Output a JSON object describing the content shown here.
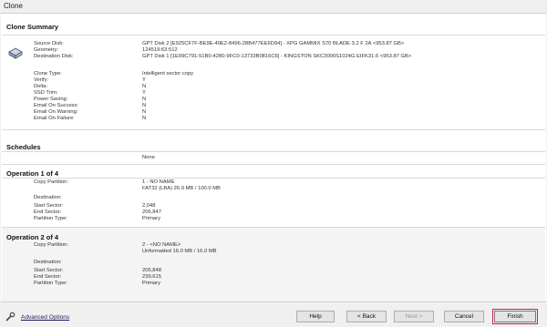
{
  "window": {
    "title": "Clone"
  },
  "clone_summary": {
    "header": "Clone Summary",
    "rows": [
      {
        "label": "Source Disk:",
        "value": "GPT Disk 2 [E925CF7F-BE9E-40E2-8496-28B477EE6D94] - XPG GAMMIX S70 BLADE 3.2 F 2A  <953.87 GB>"
      },
      {
        "label": "Geometry:",
        "value": "124519:63:512"
      },
      {
        "label": "Destination Disk:",
        "value": "GPT Disk 1 [1E09C791-51B0-4280-9FC0-13733B0816C6] - KINGSTON SKC3000S1024G EIFK31.6  <953.87 GB>"
      },
      {
        "label": "Clone Type:",
        "value": "Intelligent sector copy"
      },
      {
        "label": "Verify:",
        "value": "Y"
      },
      {
        "label": "Delta:",
        "value": "N"
      },
      {
        "label": "SSD Trim:",
        "value": "Y"
      },
      {
        "label": "Power Saving:",
        "value": "N"
      },
      {
        "label": "Email On Success:",
        "value": "N"
      },
      {
        "label": "Email On Warning:",
        "value": "N"
      },
      {
        "label": "Email On Failure:",
        "value": "N"
      }
    ]
  },
  "schedules": {
    "header": "Schedules",
    "value": "None"
  },
  "operation1": {
    "header": "Operation 1 of 4",
    "rows": [
      {
        "label": "Copy Partition:",
        "value": "1 - NO NAME"
      },
      {
        "label": "",
        "value": "FAT32 (LBA) 26.9 MB / 100.0 MB"
      },
      {
        "label": "Destination:",
        "value": ""
      },
      {
        "label": "Start Sector:",
        "value": "2,048"
      },
      {
        "label": "End Sector:",
        "value": "206,847"
      },
      {
        "label": "Partition Type:",
        "value": "Primary"
      }
    ]
  },
  "operation2": {
    "header": "Operation 2 of 4",
    "rows": [
      {
        "label": "Copy Partition:",
        "value": "2 - <NO NAME>"
      },
      {
        "label": "",
        "value": "Unformatted 16.0 MB / 16.0 MB"
      },
      {
        "label": "Destination:",
        "value": ""
      },
      {
        "label": "Start Sector:",
        "value": "206,848"
      },
      {
        "label": "End Sector:",
        "value": "239,615"
      },
      {
        "label": "Partition Type:",
        "value": "Primary"
      }
    ]
  },
  "footer": {
    "advanced_options": "Advanced Options",
    "help": "Help",
    "back": "< Back",
    "next": "Next >",
    "cancel": "Cancel",
    "finish": "Finish"
  },
  "colors": {
    "finish_highlight": "#d0204a",
    "link": "#1b1b5a"
  },
  "icons": {
    "disk": "hard-disk-icon",
    "advanced": "wrench-icon"
  }
}
